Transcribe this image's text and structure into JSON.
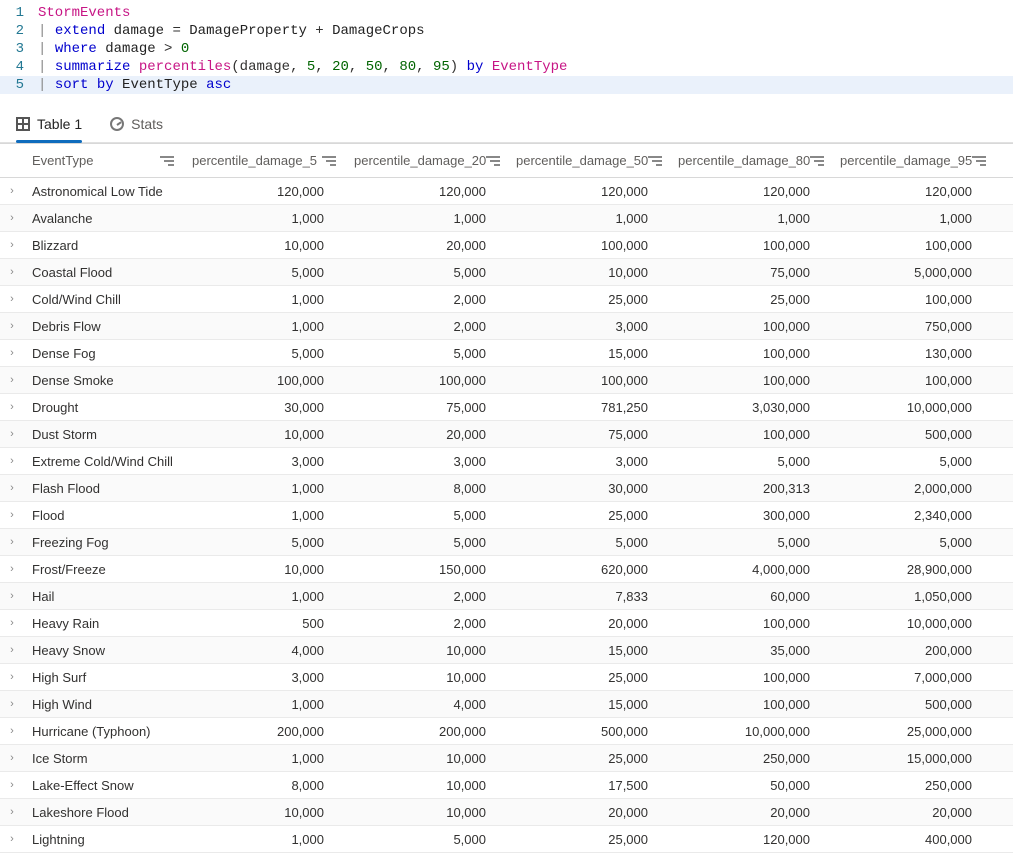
{
  "editor": {
    "lines": [
      {
        "n": "1",
        "html": "<span class='tok-ident'>StormEvents</span>"
      },
      {
        "n": "2",
        "html": "<span class='tok-pipe'>|</span> <span class='tok-kw'>extend</span> <span class='tok-assign'>damage</span> = <span class='tok-assign'>DamageProperty</span> + <span class='tok-assign'>DamageCrops</span>"
      },
      {
        "n": "3",
        "html": "<span class='tok-pipe'>|</span> <span class='tok-kw'>where</span> <span class='tok-assign'>damage</span> &gt; <span class='tok-num'>0</span>"
      },
      {
        "n": "4",
        "html": "<span class='tok-pipe'>|</span> <span class='tok-kw'>summarize</span> <span class='tok-ident'>percentiles</span>(damage, <span class='tok-num'>5</span>, <span class='tok-num'>20</span>, <span class='tok-num'>50</span>, <span class='tok-num'>80</span>, <span class='tok-num'>95</span>) <span class='tok-kw'>by</span> <span class='tok-ident'>EventType</span>"
      },
      {
        "n": "5",
        "html": "<span class='tok-pipe'>|</span> <span class='tok-kw'>sort</span> <span class='tok-kw'>by</span> <span class='tok-assign'>EventType</span> <span class='tok-kw'>asc</span>"
      }
    ],
    "highlighted_line": 5
  },
  "tabs": {
    "table_label": "Table 1",
    "stats_label": "Stats"
  },
  "grid": {
    "columns": [
      "EventType",
      "percentile_damage_5",
      "percentile_damage_20",
      "percentile_damage_50",
      "percentile_damage_80",
      "percentile_damage_95"
    ],
    "rows": [
      {
        "name": "Astronomical Low Tide",
        "v": [
          "120,000",
          "120,000",
          "120,000",
          "120,000",
          "120,000"
        ]
      },
      {
        "name": "Avalanche",
        "v": [
          "1,000",
          "1,000",
          "1,000",
          "1,000",
          "1,000"
        ]
      },
      {
        "name": "Blizzard",
        "v": [
          "10,000",
          "20,000",
          "100,000",
          "100,000",
          "100,000"
        ]
      },
      {
        "name": "Coastal Flood",
        "v": [
          "5,000",
          "5,000",
          "10,000",
          "75,000",
          "5,000,000"
        ]
      },
      {
        "name": "Cold/Wind Chill",
        "v": [
          "1,000",
          "2,000",
          "25,000",
          "25,000",
          "100,000"
        ]
      },
      {
        "name": "Debris Flow",
        "v": [
          "1,000",
          "2,000",
          "3,000",
          "100,000",
          "750,000"
        ]
      },
      {
        "name": "Dense Fog",
        "v": [
          "5,000",
          "5,000",
          "15,000",
          "100,000",
          "130,000"
        ]
      },
      {
        "name": "Dense Smoke",
        "v": [
          "100,000",
          "100,000",
          "100,000",
          "100,000",
          "100,000"
        ]
      },
      {
        "name": "Drought",
        "v": [
          "30,000",
          "75,000",
          "781,250",
          "3,030,000",
          "10,000,000"
        ]
      },
      {
        "name": "Dust Storm",
        "v": [
          "10,000",
          "20,000",
          "75,000",
          "100,000",
          "500,000"
        ]
      },
      {
        "name": "Extreme Cold/Wind Chill",
        "v": [
          "3,000",
          "3,000",
          "3,000",
          "5,000",
          "5,000"
        ]
      },
      {
        "name": "Flash Flood",
        "v": [
          "1,000",
          "8,000",
          "30,000",
          "200,313",
          "2,000,000"
        ]
      },
      {
        "name": "Flood",
        "v": [
          "1,000",
          "5,000",
          "25,000",
          "300,000",
          "2,340,000"
        ]
      },
      {
        "name": "Freezing Fog",
        "v": [
          "5,000",
          "5,000",
          "5,000",
          "5,000",
          "5,000"
        ]
      },
      {
        "name": "Frost/Freeze",
        "v": [
          "10,000",
          "150,000",
          "620,000",
          "4,000,000",
          "28,900,000"
        ]
      },
      {
        "name": "Hail",
        "v": [
          "1,000",
          "2,000",
          "7,833",
          "60,000",
          "1,050,000"
        ]
      },
      {
        "name": "Heavy Rain",
        "v": [
          "500",
          "2,000",
          "20,000",
          "100,000",
          "10,000,000"
        ]
      },
      {
        "name": "Heavy Snow",
        "v": [
          "4,000",
          "10,000",
          "15,000",
          "35,000",
          "200,000"
        ]
      },
      {
        "name": "High Surf",
        "v": [
          "3,000",
          "10,000",
          "25,000",
          "100,000",
          "7,000,000"
        ]
      },
      {
        "name": "High Wind",
        "v": [
          "1,000",
          "4,000",
          "15,000",
          "100,000",
          "500,000"
        ]
      },
      {
        "name": "Hurricane (Typhoon)",
        "v": [
          "200,000",
          "200,000",
          "500,000",
          "10,000,000",
          "25,000,000"
        ]
      },
      {
        "name": "Ice Storm",
        "v": [
          "1,000",
          "10,000",
          "25,000",
          "250,000",
          "15,000,000"
        ]
      },
      {
        "name": "Lake-Effect Snow",
        "v": [
          "8,000",
          "10,000",
          "17,500",
          "50,000",
          "250,000"
        ]
      },
      {
        "name": "Lakeshore Flood",
        "v": [
          "10,000",
          "10,000",
          "20,000",
          "20,000",
          "20,000"
        ]
      },
      {
        "name": "Lightning",
        "v": [
          "1,000",
          "5,000",
          "25,000",
          "120,000",
          "400,000"
        ]
      }
    ]
  }
}
